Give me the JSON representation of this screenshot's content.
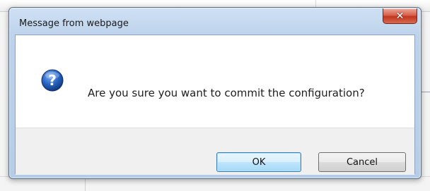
{
  "dialog": {
    "title": "Message from webpage",
    "close_icon": "close-x-icon",
    "message": "Are you sure you want to commit the configuration?",
    "icon": "question-icon",
    "buttons": {
      "ok_label": "OK",
      "cancel_label": "Cancel"
    },
    "colors": {
      "close_button": "#c7432c",
      "icon_blue": "#1f5fb4",
      "ok_border": "#3c7fb1"
    }
  }
}
